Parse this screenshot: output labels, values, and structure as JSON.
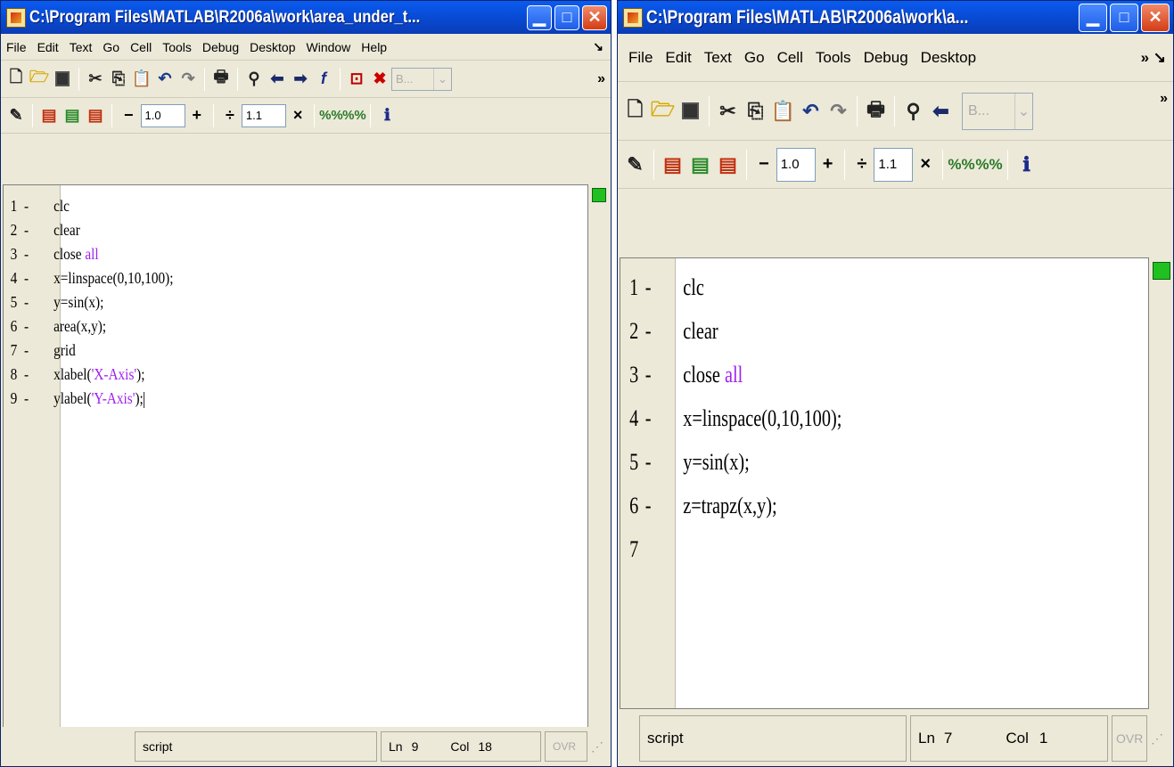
{
  "left_window": {
    "title": "C:\\Program Files\\MATLAB\\R2006a\\work\\area_under_t...",
    "menu": [
      "File",
      "Edit",
      "Text",
      "Go",
      "Cell",
      "Tools",
      "Debug",
      "Desktop",
      "Window",
      "Help"
    ],
    "menu_more": "↘",
    "toolbar_more": "»",
    "combo_value": "B...",
    "cell_increment": "1.0",
    "cell_factor": "1.1",
    "status": {
      "mode": "script",
      "ln_label": "Ln",
      "ln": "9",
      "col_label": "Col",
      "col": "18",
      "ovr": "OVR"
    }
  },
  "right_window": {
    "title": "C:\\Program Files\\MATLAB\\R2006a\\work\\a...",
    "menu": [
      "File",
      "Edit",
      "Text",
      "Go",
      "Cell",
      "Tools",
      "Debug",
      "Desktop"
    ],
    "menu_more": "» ↘",
    "toolbar_more": "»",
    "combo_value": "B...",
    "cell_increment": "1.0",
    "cell_factor": "1.1",
    "status": {
      "mode": "script",
      "ln_label": "Ln",
      "ln": "7",
      "col_label": "Col",
      "col": "1",
      "ovr": "OVR"
    }
  },
  "icons": {
    "new": "new-file-icon",
    "open": "open-folder-icon",
    "save": "save-icon",
    "cut": "cut-icon",
    "copy": "copy-icon",
    "paste": "paste-icon",
    "undo": "undo-icon",
    "redo": "redo-icon",
    "print": "print-icon",
    "find": "binoculars-icon",
    "back": "back-arrow-icon",
    "forward": "forward-arrow-icon",
    "function": "function-icon",
    "breakpoint": "set-breakpoint-icon",
    "clear_breakpoints": "clear-breakpoints-icon",
    "cell_eval": "evaluate-cell-icon",
    "insert_cell": "insert-cell-icon",
    "next_cell": "next-cell-icon",
    "percent_plus": "insert-cell-divider-icon",
    "percent_minus": "cell-options-icon",
    "info": "help-info-icon"
  },
  "colors": {
    "titlebar": "#0a5bf0",
    "keyword": "#a020f0",
    "string": "#a020f0",
    "mlint_ok": "#20c020",
    "close_button": "#d43c14"
  },
  "left_code": [
    {
      "n": "1",
      "d": "-",
      "t": "clc"
    },
    {
      "n": "2",
      "d": "-",
      "t": "clear"
    },
    {
      "n": "3",
      "d": "-",
      "t": "close ",
      "kw": "all"
    },
    {
      "n": "4",
      "d": "-",
      "t": "x=linspace(0,10,100);"
    },
    {
      "n": "5",
      "d": "-",
      "t": "y=sin(x);"
    },
    {
      "n": "6",
      "d": "-",
      "t": "area(x,y);"
    },
    {
      "n": "7",
      "d": "-",
      "t": "grid"
    },
    {
      "n": "8",
      "d": "-",
      "t": "xlabel(",
      "str": "'X-Axis'",
      "after": ");"
    },
    {
      "n": "9",
      "d": "-",
      "t": "ylabel(",
      "str": "'Y-Axis'",
      "after": ");",
      "caret": true
    }
  ],
  "right_code": [
    {
      "n": "1",
      "d": "-",
      "t": "clc"
    },
    {
      "n": "2",
      "d": "-",
      "t": "clear"
    },
    {
      "n": "3",
      "d": "-",
      "t": "close ",
      "kw": "all"
    },
    {
      "n": "4",
      "d": "-",
      "t": "x=linspace(0,10,100);"
    },
    {
      "n": "5",
      "d": "-",
      "t": "y=sin(x);"
    },
    {
      "n": "6",
      "d": "-",
      "t": "z=trapz(x,y);"
    },
    {
      "n": "7",
      "d": "",
      "t": ""
    }
  ]
}
